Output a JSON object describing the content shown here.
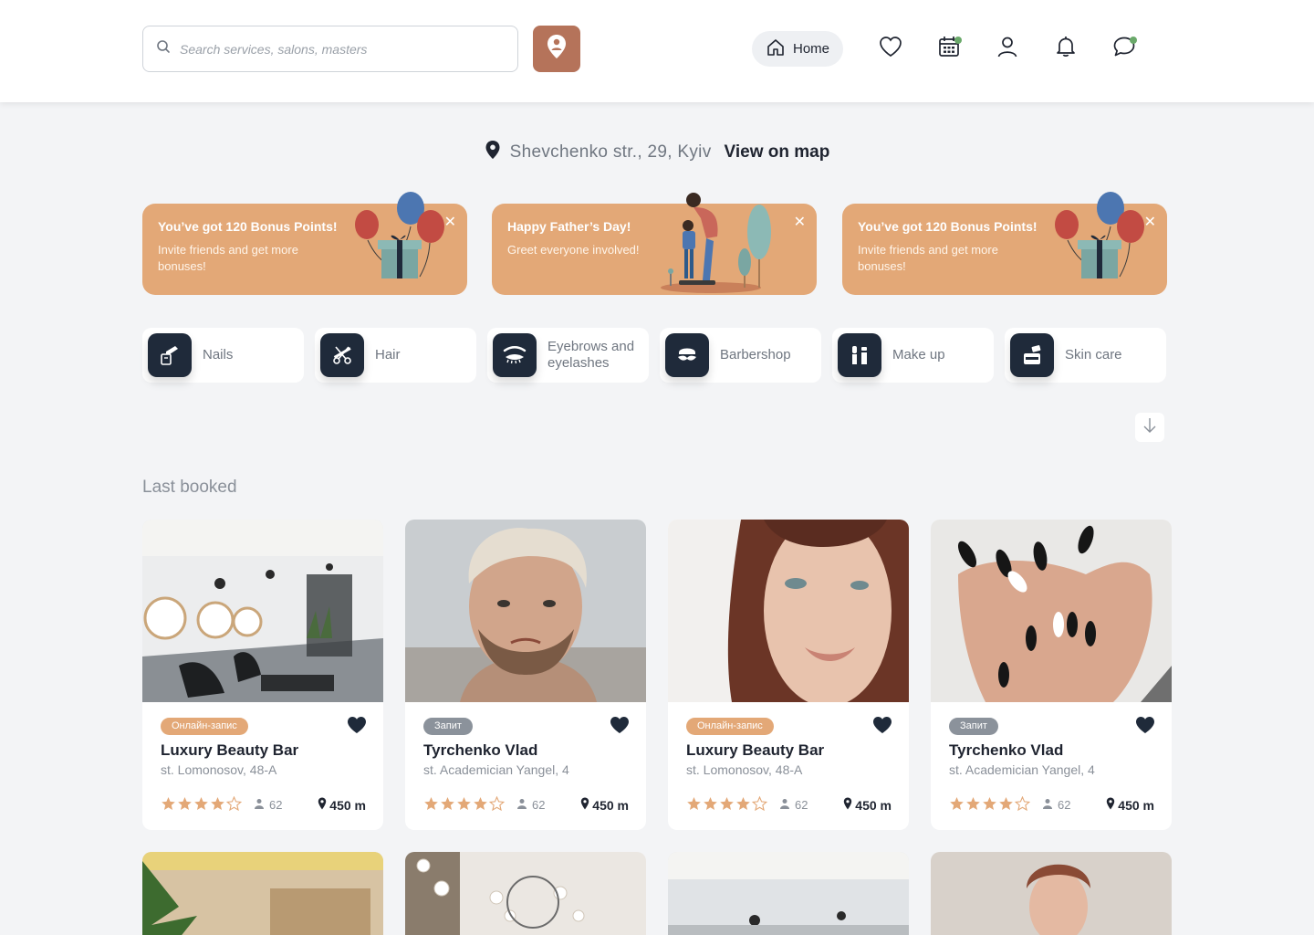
{
  "header": {
    "search_placeholder": "Search services, salons, masters",
    "home_label": "Home",
    "accent_color": "#b5735a"
  },
  "location": {
    "address": "Shevchenko str., 29, Kyiv",
    "map_link": "View on map"
  },
  "banners": [
    {
      "title": "You’ve got 120 Bonus Points!",
      "subtitle": "Invite friends and get more bonuses!"
    },
    {
      "title": "Happy Father’s Day!",
      "subtitle": "Greet everyone involved!"
    },
    {
      "title": "You’ve got 120 Bonus Points!",
      "subtitle": "Invite friends and get more bonuses!"
    }
  ],
  "categories": [
    {
      "label": "Nails",
      "icon": "nail-polish-icon"
    },
    {
      "label": "Hair",
      "icon": "scissors-comb-icon"
    },
    {
      "label": "Eyebrows and eyelashes",
      "icon": "eye-lashes-icon"
    },
    {
      "label": "Barbershop",
      "icon": "mustache-icon"
    },
    {
      "label": "Make up",
      "icon": "makeup-brushes-icon"
    },
    {
      "label": "Skin care",
      "icon": "cream-jar-icon"
    }
  ],
  "section_title": "Last booked",
  "cards": [
    {
      "badge": "Онлайн-запис",
      "badge_type": "online",
      "name": "Luxury Beauty Bar",
      "address": "st. Lomonosov, 48-A",
      "rating": 4,
      "reviews": "62",
      "distance": "450 m"
    },
    {
      "badge": "Запит",
      "badge_type": "request",
      "name": "Tyrchenko Vlad",
      "address": "st. Academician Yangel, 4",
      "rating": 4,
      "reviews": "62",
      "distance": "450 m"
    },
    {
      "badge": "Онлайн-запис",
      "badge_type": "online",
      "name": "Luxury Beauty Bar",
      "address": "st. Lomonosov, 48-A",
      "rating": 4,
      "reviews": "62",
      "distance": "450 m"
    },
    {
      "badge": "Запит",
      "badge_type": "request",
      "name": "Tyrchenko Vlad",
      "address": "st. Academician Yangel, 4",
      "rating": 4,
      "reviews": "62",
      "distance": "450 m"
    }
  ]
}
